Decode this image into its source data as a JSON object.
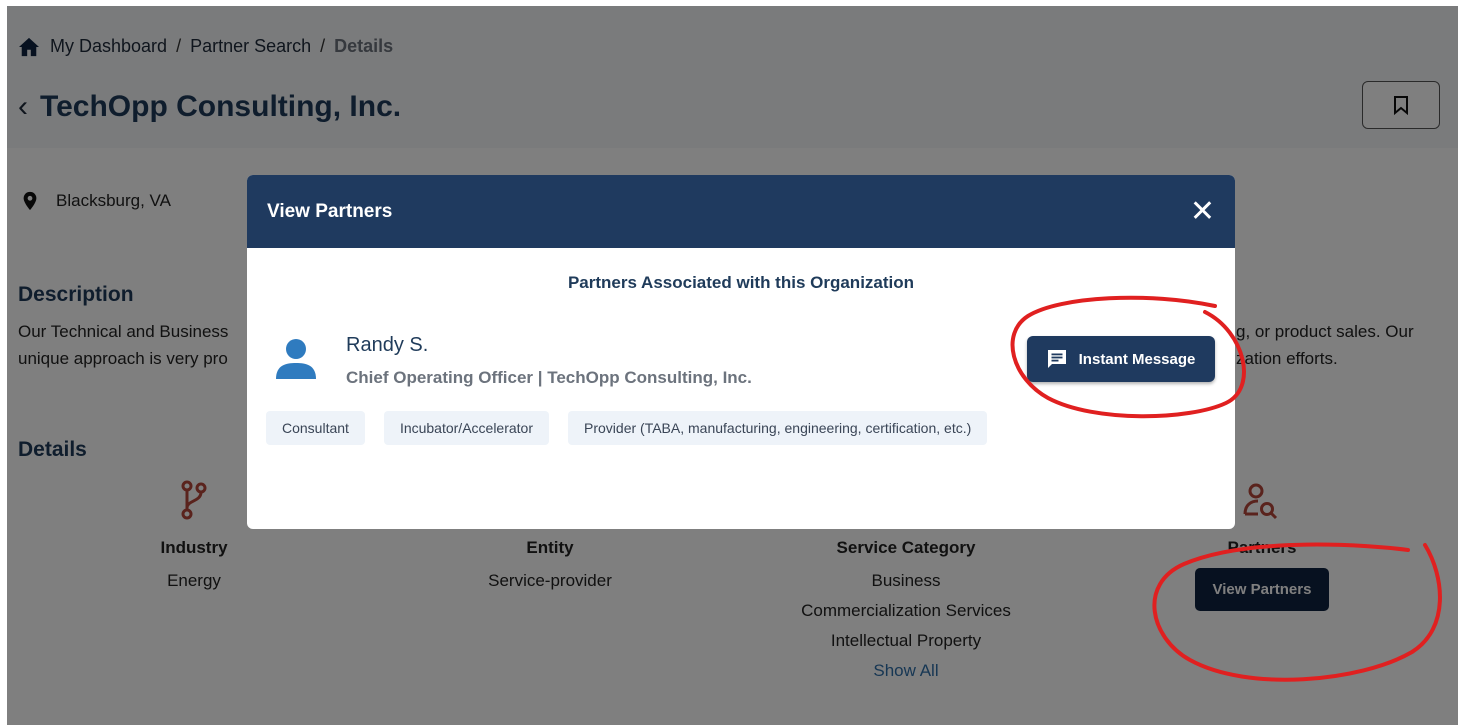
{
  "breadcrumb": {
    "items": [
      "My Dashboard",
      "Partner Search"
    ],
    "current": "Details",
    "separator": "/"
  },
  "page": {
    "title": "TechOpp Consulting, Inc.",
    "location": "Blacksburg, VA"
  },
  "description": {
    "heading": "Description",
    "left_line1": "Our Technical and Business",
    "left_line2": "unique approach is very pro",
    "right_line1": "g, or product sales. Our",
    "right_line2": "zation efforts."
  },
  "details": {
    "heading": "Details",
    "industry": {
      "label": "Industry",
      "value": "Energy",
      "icon": "branch-icon"
    },
    "entity": {
      "label": "Entity",
      "value": "Service-provider"
    },
    "service_category": {
      "label": "Service Category",
      "values": [
        "Business",
        "Commercialization Services",
        "Intellectual Property"
      ],
      "show_all": "Show All"
    },
    "partners": {
      "label": "Partners",
      "button": "View Partners",
      "icon": "user-search-icon"
    }
  },
  "modal": {
    "title": "View Partners",
    "subtitle": "Partners Associated with this Organization",
    "partner": {
      "name": "Randy S.",
      "role": "Chief Operating Officer | TechOpp Consulting, Inc.",
      "tags": [
        "Consultant",
        "Incubator/Accelerator",
        "Provider (TABA, manufacturing, engineering, certification, etc.)"
      ],
      "message_button": "Instant Message"
    }
  },
  "colors": {
    "navy": "#1f3a5f",
    "dark_navy": "#0f2340",
    "icon_red": "#b5473a",
    "annotation_red": "#e02020",
    "link_blue": "#2f6fa8"
  }
}
